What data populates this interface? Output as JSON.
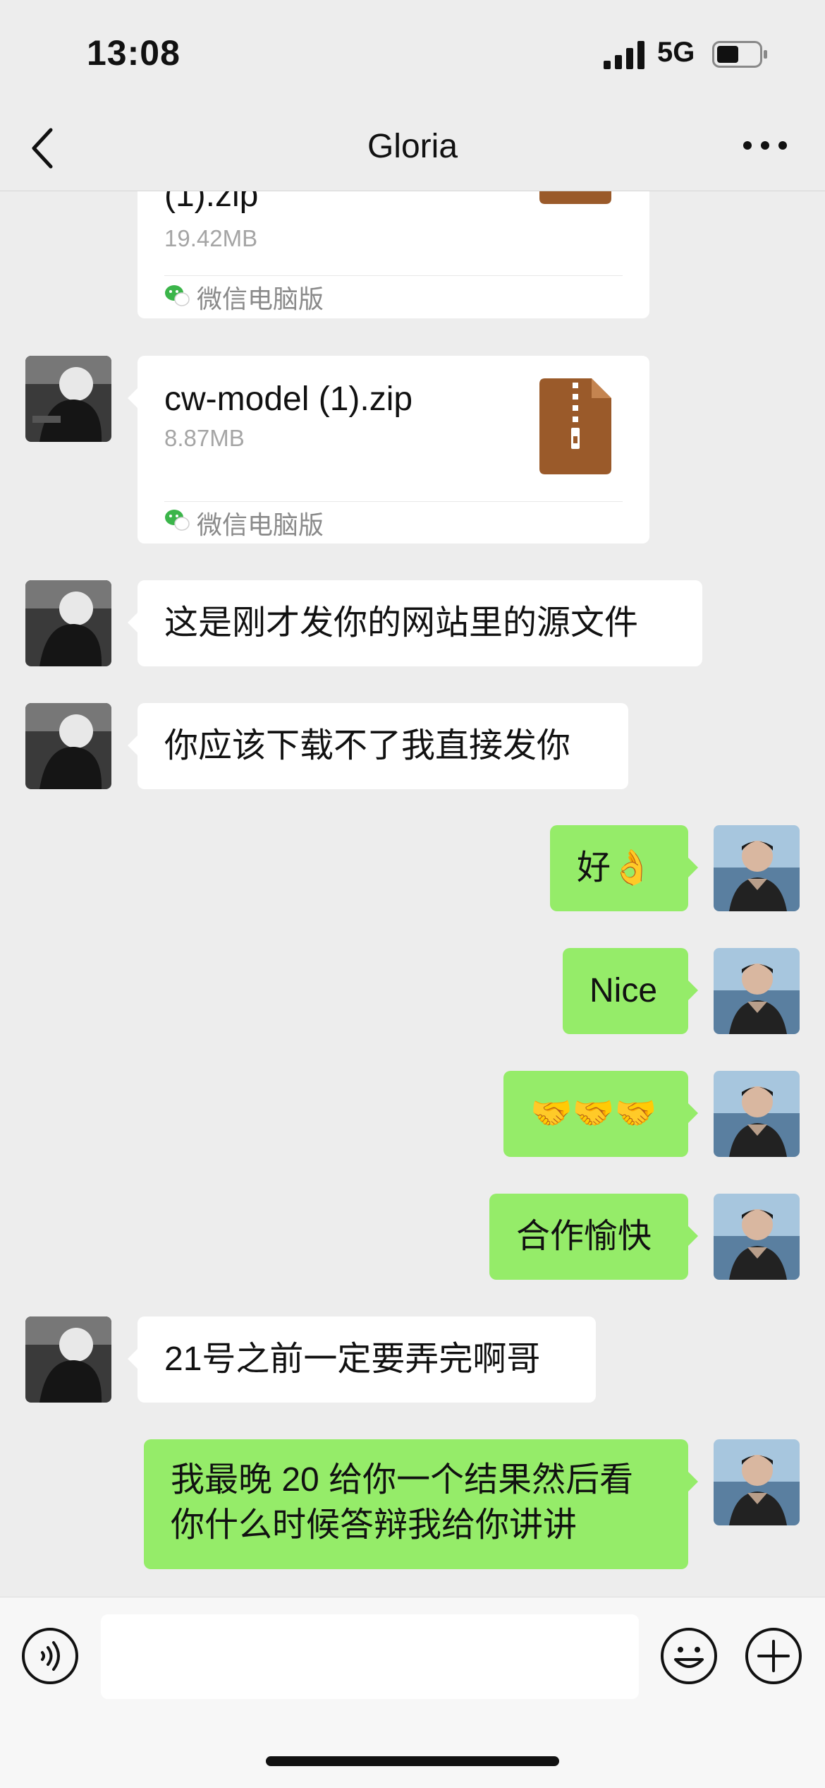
{
  "status_bar": {
    "time": "13:08",
    "network": "5G"
  },
  "nav": {
    "title": "Gloria"
  },
  "files": [
    {
      "name": "(1).zip",
      "size": "19.42MB",
      "source": "微信电脑版"
    },
    {
      "name": "cw-model (1).zip",
      "size": "8.87MB",
      "source": "微信电脑版"
    }
  ],
  "messages": [
    {
      "from": "Gloria",
      "text": "这是刚才发你的网站里的源文件"
    },
    {
      "from": "Gloria",
      "text": "你应该下载不了我直接发你"
    },
    {
      "from": "me",
      "text": "好👌"
    },
    {
      "from": "me",
      "text": "Nice"
    },
    {
      "from": "me",
      "text": "🤝🤝🤝"
    },
    {
      "from": "me",
      "text": "合作愉快"
    },
    {
      "from": "Gloria",
      "text": "21号之前一定要弄完啊哥"
    },
    {
      "from": "me",
      "text": "我最晚 20 给你一个结果然后看你什么时候答辩我给你讲讲"
    }
  ],
  "input": {
    "value": "",
    "placeholder": ""
  },
  "icons": [
    "back-icon",
    "more-icon",
    "voice-icon",
    "emoji-icon",
    "plus-icon",
    "zip-file-icon",
    "wechat-pc-icon",
    "signal-icon",
    "battery-icon"
  ],
  "colors": {
    "background": "#ededed",
    "outgoing_bubble": "#95ec69",
    "incoming_bubble": "#ffffff",
    "zip_icon": "#9a5a2a"
  }
}
